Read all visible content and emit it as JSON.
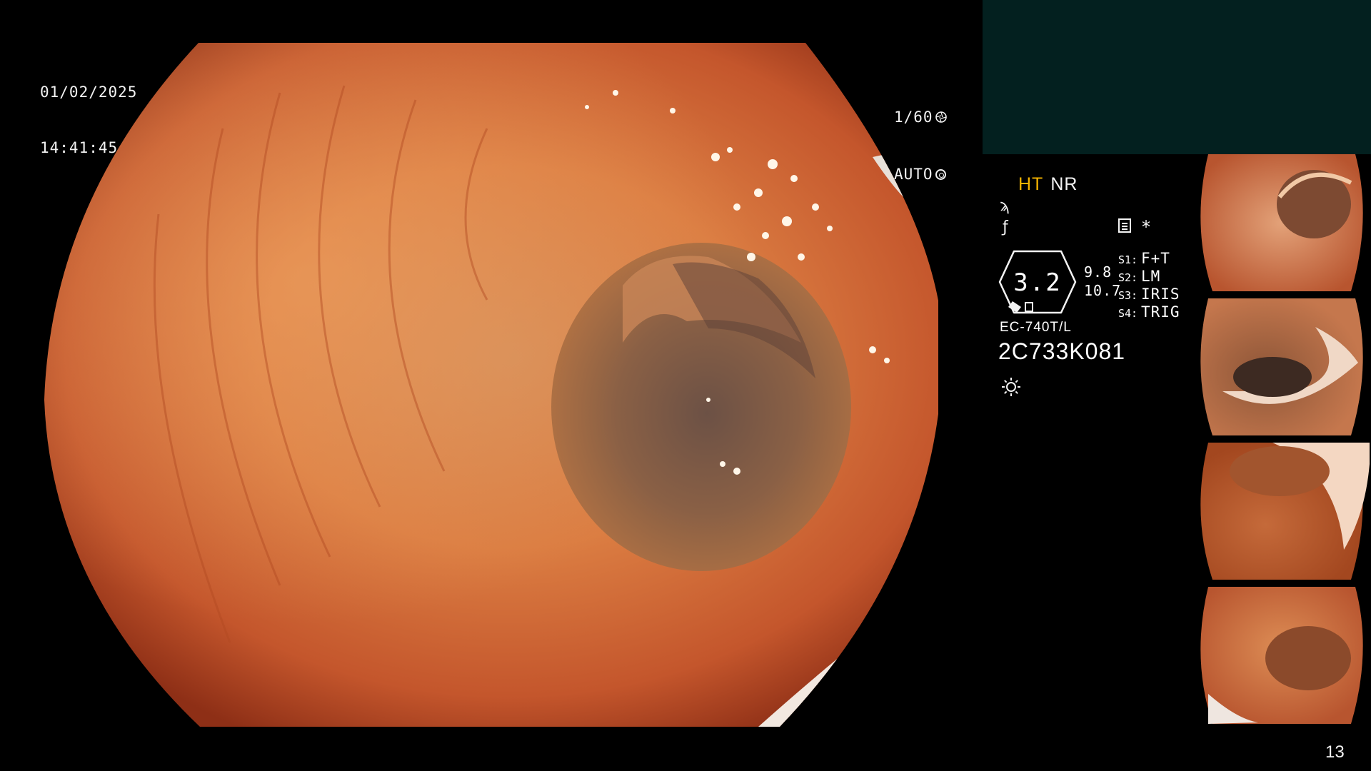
{
  "osd": {
    "date": "01/02/2025",
    "time": "14:41:45",
    "shutter": "1/60",
    "exposure": "AUTO"
  },
  "info": {
    "mode_ht": "HT",
    "mode_nr": "NR",
    "zoom": "3.2",
    "value_top": "9.8",
    "value_bottom": "10.7",
    "switches": [
      {
        "key": "S1:",
        "value": "F+T"
      },
      {
        "key": "S2:",
        "value": "LM"
      },
      {
        "key": "S3:",
        "value": "IRIS"
      },
      {
        "key": "S4:",
        "value": "TRIG"
      }
    ],
    "model": "EC-740T/L",
    "serial": "2C733K081"
  },
  "icons": {
    "shutter": "aperture-icon",
    "exposure": "ring-icon",
    "curve": "curve-icon",
    "enhance": "enhance-icon",
    "document": "document-icon",
    "star": "asterisk-icon",
    "light": "sun-icon"
  },
  "colors": {
    "accent_ht": "#f5b400",
    "panel_bg": "#03201f",
    "text": "#f2f2f2"
  },
  "thumbnails": [
    {
      "id": "thumb-1"
    },
    {
      "id": "thumb-2"
    },
    {
      "id": "thumb-3"
    },
    {
      "id": "thumb-4"
    }
  ],
  "page_number": "13"
}
